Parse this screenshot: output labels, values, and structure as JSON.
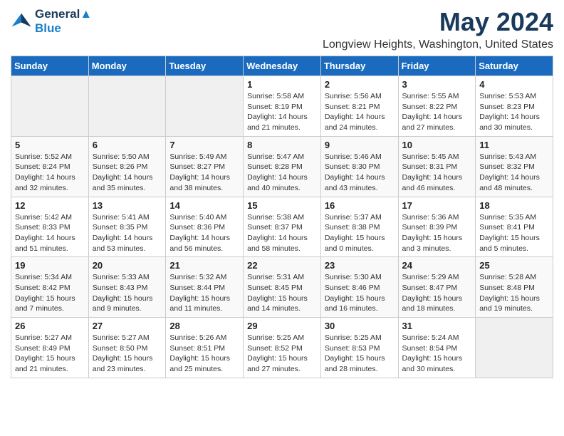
{
  "logo": {
    "line1": "General",
    "line2": "Blue"
  },
  "title": "May 2024",
  "subtitle": "Longview Heights, Washington, United States",
  "headers": [
    "Sunday",
    "Monday",
    "Tuesday",
    "Wednesday",
    "Thursday",
    "Friday",
    "Saturday"
  ],
  "weeks": [
    [
      {
        "day": "",
        "info": ""
      },
      {
        "day": "",
        "info": ""
      },
      {
        "day": "",
        "info": ""
      },
      {
        "day": "1",
        "info": "Sunrise: 5:58 AM\nSunset: 8:19 PM\nDaylight: 14 hours\nand 21 minutes."
      },
      {
        "day": "2",
        "info": "Sunrise: 5:56 AM\nSunset: 8:21 PM\nDaylight: 14 hours\nand 24 minutes."
      },
      {
        "day": "3",
        "info": "Sunrise: 5:55 AM\nSunset: 8:22 PM\nDaylight: 14 hours\nand 27 minutes."
      },
      {
        "day": "4",
        "info": "Sunrise: 5:53 AM\nSunset: 8:23 PM\nDaylight: 14 hours\nand 30 minutes."
      }
    ],
    [
      {
        "day": "5",
        "info": "Sunrise: 5:52 AM\nSunset: 8:24 PM\nDaylight: 14 hours\nand 32 minutes."
      },
      {
        "day": "6",
        "info": "Sunrise: 5:50 AM\nSunset: 8:26 PM\nDaylight: 14 hours\nand 35 minutes."
      },
      {
        "day": "7",
        "info": "Sunrise: 5:49 AM\nSunset: 8:27 PM\nDaylight: 14 hours\nand 38 minutes."
      },
      {
        "day": "8",
        "info": "Sunrise: 5:47 AM\nSunset: 8:28 PM\nDaylight: 14 hours\nand 40 minutes."
      },
      {
        "day": "9",
        "info": "Sunrise: 5:46 AM\nSunset: 8:30 PM\nDaylight: 14 hours\nand 43 minutes."
      },
      {
        "day": "10",
        "info": "Sunrise: 5:45 AM\nSunset: 8:31 PM\nDaylight: 14 hours\nand 46 minutes."
      },
      {
        "day": "11",
        "info": "Sunrise: 5:43 AM\nSunset: 8:32 PM\nDaylight: 14 hours\nand 48 minutes."
      }
    ],
    [
      {
        "day": "12",
        "info": "Sunrise: 5:42 AM\nSunset: 8:33 PM\nDaylight: 14 hours\nand 51 minutes."
      },
      {
        "day": "13",
        "info": "Sunrise: 5:41 AM\nSunset: 8:35 PM\nDaylight: 14 hours\nand 53 minutes."
      },
      {
        "day": "14",
        "info": "Sunrise: 5:40 AM\nSunset: 8:36 PM\nDaylight: 14 hours\nand 56 minutes."
      },
      {
        "day": "15",
        "info": "Sunrise: 5:38 AM\nSunset: 8:37 PM\nDaylight: 14 hours\nand 58 minutes."
      },
      {
        "day": "16",
        "info": "Sunrise: 5:37 AM\nSunset: 8:38 PM\nDaylight: 15 hours\nand 0 minutes."
      },
      {
        "day": "17",
        "info": "Sunrise: 5:36 AM\nSunset: 8:39 PM\nDaylight: 15 hours\nand 3 minutes."
      },
      {
        "day": "18",
        "info": "Sunrise: 5:35 AM\nSunset: 8:41 PM\nDaylight: 15 hours\nand 5 minutes."
      }
    ],
    [
      {
        "day": "19",
        "info": "Sunrise: 5:34 AM\nSunset: 8:42 PM\nDaylight: 15 hours\nand 7 minutes."
      },
      {
        "day": "20",
        "info": "Sunrise: 5:33 AM\nSunset: 8:43 PM\nDaylight: 15 hours\nand 9 minutes."
      },
      {
        "day": "21",
        "info": "Sunrise: 5:32 AM\nSunset: 8:44 PM\nDaylight: 15 hours\nand 11 minutes."
      },
      {
        "day": "22",
        "info": "Sunrise: 5:31 AM\nSunset: 8:45 PM\nDaylight: 15 hours\nand 14 minutes."
      },
      {
        "day": "23",
        "info": "Sunrise: 5:30 AM\nSunset: 8:46 PM\nDaylight: 15 hours\nand 16 minutes."
      },
      {
        "day": "24",
        "info": "Sunrise: 5:29 AM\nSunset: 8:47 PM\nDaylight: 15 hours\nand 18 minutes."
      },
      {
        "day": "25",
        "info": "Sunrise: 5:28 AM\nSunset: 8:48 PM\nDaylight: 15 hours\nand 19 minutes."
      }
    ],
    [
      {
        "day": "26",
        "info": "Sunrise: 5:27 AM\nSunset: 8:49 PM\nDaylight: 15 hours\nand 21 minutes."
      },
      {
        "day": "27",
        "info": "Sunrise: 5:27 AM\nSunset: 8:50 PM\nDaylight: 15 hours\nand 23 minutes."
      },
      {
        "day": "28",
        "info": "Sunrise: 5:26 AM\nSunset: 8:51 PM\nDaylight: 15 hours\nand 25 minutes."
      },
      {
        "day": "29",
        "info": "Sunrise: 5:25 AM\nSunset: 8:52 PM\nDaylight: 15 hours\nand 27 minutes."
      },
      {
        "day": "30",
        "info": "Sunrise: 5:25 AM\nSunset: 8:53 PM\nDaylight: 15 hours\nand 28 minutes."
      },
      {
        "day": "31",
        "info": "Sunrise: 5:24 AM\nSunset: 8:54 PM\nDaylight: 15 hours\nand 30 minutes."
      },
      {
        "day": "",
        "info": ""
      }
    ]
  ]
}
